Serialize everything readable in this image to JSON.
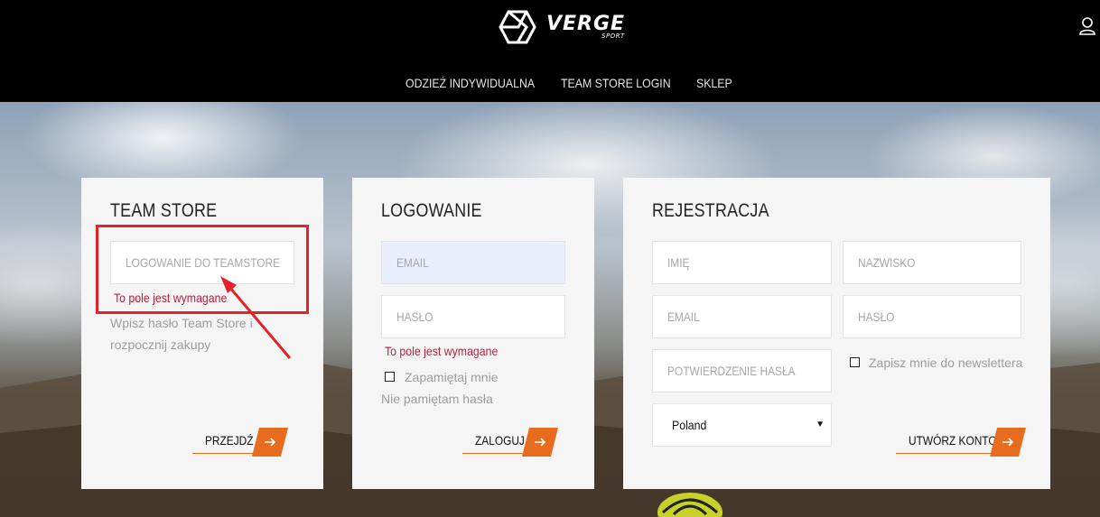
{
  "header": {
    "brand": "VERGE",
    "brand_sub": "SPORT",
    "nav": [
      "ODZIEŻ INDYWIDUALNA",
      "TEAM STORE LOGIN",
      "SKLEP"
    ],
    "user_icon": "user-icon"
  },
  "team_store": {
    "title": "TEAM STORE",
    "input_placeholder": "LOGOWANIE DO TEAMSTORE",
    "error": "To pole jest wymagane",
    "help_line1": "Wpisz hasło Team Store i",
    "help_line2": "rozpocznij zakupy",
    "button": "PRZEJDŹ"
  },
  "login": {
    "title": "LOGOWANIE",
    "email_placeholder": "EMAIL",
    "password_placeholder": "HASŁO",
    "error": "To pole jest wymagane",
    "remember": "Zapamiętaj mnie",
    "forgot": "Nie pamiętam hasła",
    "button": "ZALOGUJ"
  },
  "register": {
    "title": "REJESTRACJA",
    "first_name": "IMIĘ",
    "last_name": "NAZWISKO",
    "email": "EMAIL",
    "password": "HASŁO",
    "password_confirm": "POTWIERDZENIE HASŁA",
    "newsletter": "Zapisz mnie do newslettera",
    "country": "Poland",
    "button": "UTWÓRZ KONTO"
  },
  "colors": {
    "accent": "#e86c1e",
    "error": "#c01a3a",
    "annotation": "#e4222a"
  }
}
